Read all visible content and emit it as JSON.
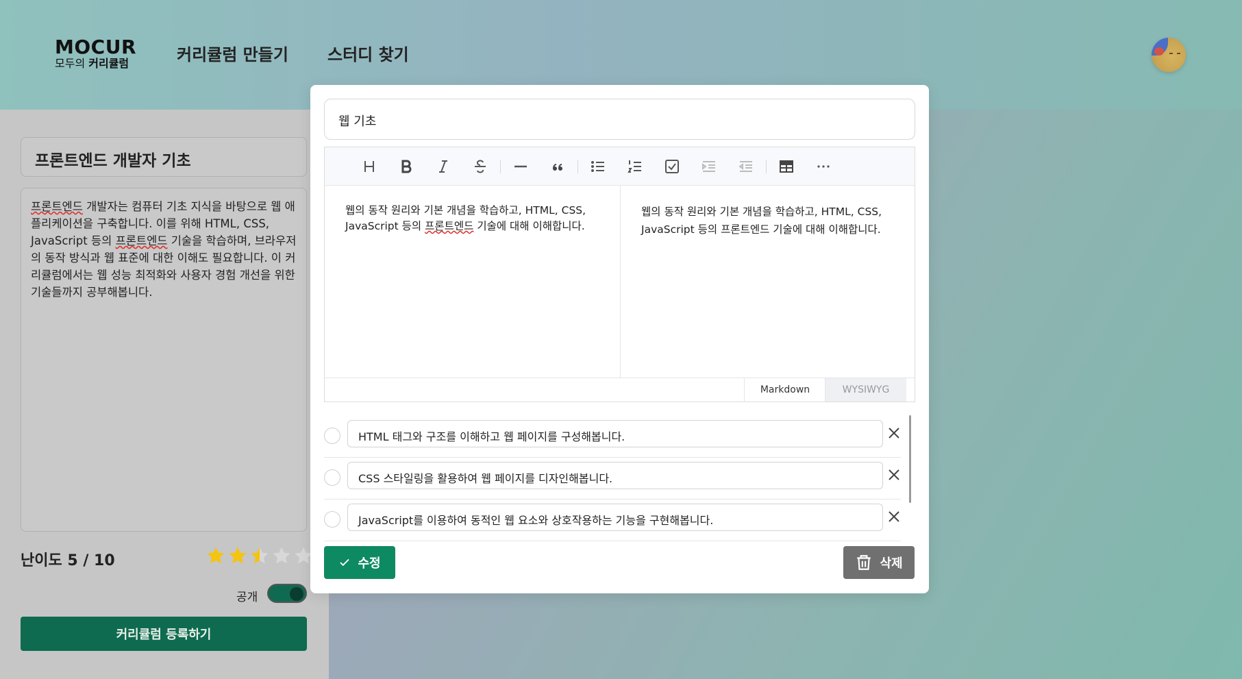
{
  "header": {
    "logo_title": "MOCUR",
    "logo_sub_prefix": "모두의 ",
    "logo_sub_bold": "커리큘럼",
    "nav": [
      "커리큘럼 만들기",
      "스터디 찾기"
    ]
  },
  "left_panel": {
    "title": "프론트엔드 개발자 기초",
    "description_parts": [
      {
        "text": "프론트엔드",
        "spell": true
      },
      {
        "text": " 개발자는 컴퓨터 기초 지식을 바탕으로 웹 애플리케이션을 구축합니다. 이를 위해 HTML, CSS, JavaScript 등의 ",
        "spell": false
      },
      {
        "text": "프론트엔드",
        "spell": true
      },
      {
        "text": " 기술을 학습하며, 브라우저의 동작 방식과 웹 표준에 대한 이해도 필요합니다. 이 커리큘럼에서는 웹 성능 최적화와 사용자 경험 개선을 위한 기술들까지 공부해봅니다.",
        "spell": false
      }
    ],
    "difficulty_label": "난이도 5 / 10",
    "rating": 2.5,
    "rating_max": 5,
    "public_label": "공개",
    "public_on": true,
    "register_button": "커리큘럼 등록하기"
  },
  "modal": {
    "title_value": "웹 기초",
    "toolbar": [
      "heading-icon",
      "bold-icon",
      "italic-icon",
      "strike-icon",
      "hr-icon",
      "quote-icon",
      "bullet-list-icon",
      "ordered-list-icon",
      "task-icon",
      "indent-icon",
      "outdent-icon",
      "table-icon",
      "more-icon"
    ],
    "editor_left": {
      "p1": "웹의 동작 원리와 기본 개념을 학습하고, HTML, CSS, JavaScript 등의 ",
      "spell": "프론트엔드",
      "p2": " 기술에 대해 이해합니다."
    },
    "editor_right": "웹의 동작 원리와 기본 개념을 학습하고, HTML, CSS, JavaScript 등의 프론트엔드 기술에 대해 이해합니다.",
    "mode_tabs": [
      "Markdown",
      "WYSIWYG"
    ],
    "todos": [
      "HTML 태그와 구조를 이해하고 웹 페이지를 구성해봅니다.",
      "CSS 스타일링을 활용하여 웹 페이지를 디자인해봅니다.",
      "JavaScript를 이용하여 동적인 웹 요소와 상호작용하는 기능을 구현해봅니다."
    ],
    "edit_button": "수정",
    "delete_button": "삭제"
  },
  "colors": {
    "primary": "#0e8a63",
    "register": "#0e6b50",
    "star": "#f4c40f"
  }
}
